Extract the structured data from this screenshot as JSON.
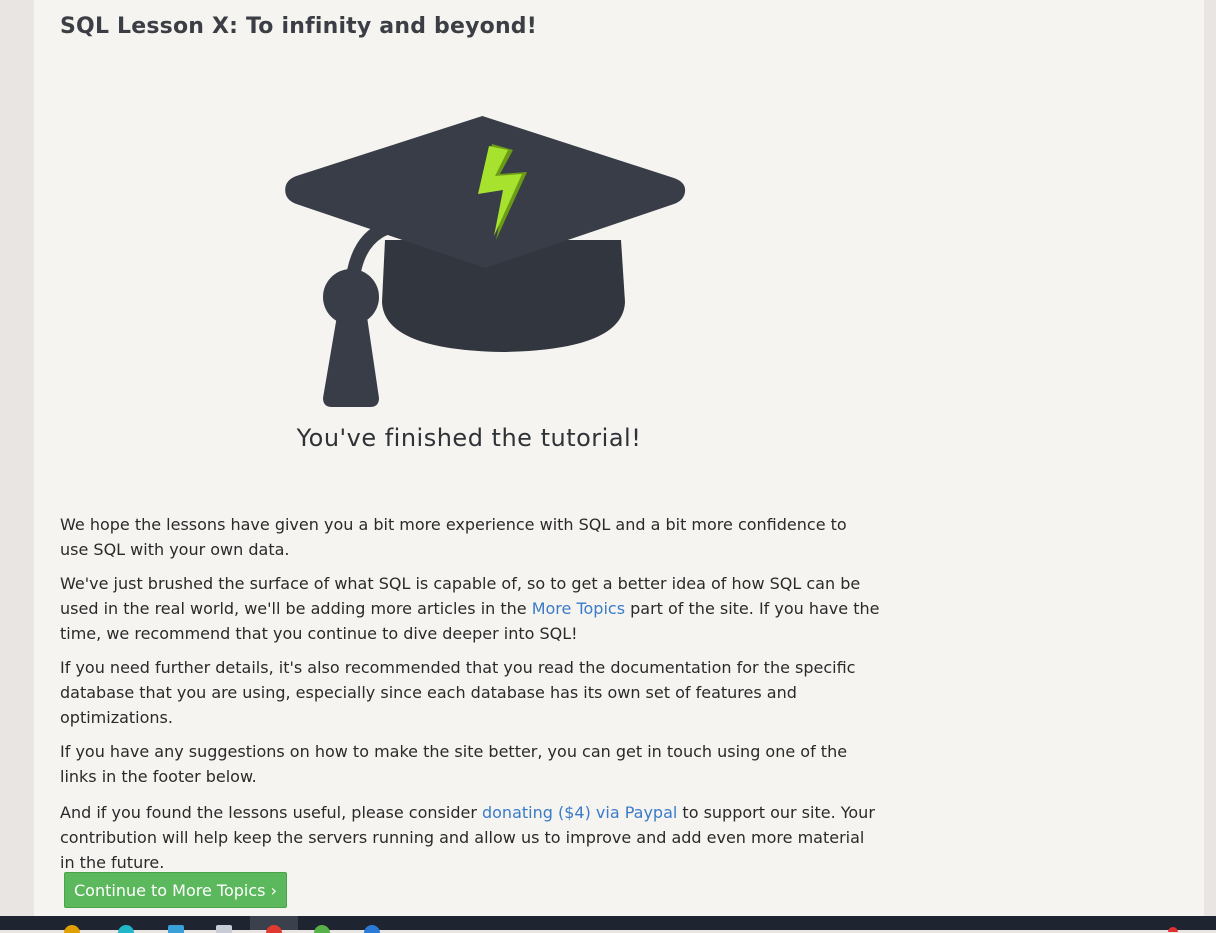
{
  "lesson": {
    "title": "SQL Lesson X: To infinity and beyond!",
    "finished_heading": "You've finished the tutorial!"
  },
  "paragraphs": {
    "p1": "We hope the lessons have given you a bit more experience with SQL and a bit more confidence to use SQL with your own data.",
    "p2_before": "We've just brushed the surface of what SQL is capable of, so to get a better idea of how SQL can be used in the real world, we'll be adding more articles in the ",
    "p2_link": "More Topics",
    "p2_after": " part of the site. If you have the time, we recommend that you continue to dive deeper into SQL!",
    "p3": "If you need further details, it's also recommended that you read the documentation for the specific database that you are using, especially since each database has its own set of features and optimizations.",
    "p4": "If you have any suggestions on how to make the site better, you can get in touch using one of the links in the footer below.",
    "p5_before": "And if you found the lessons useful, please consider ",
    "p5_link": "donating ($4) via Paypal",
    "p5_after": " to support our site. Your contribution will help keep the servers running and allow us to improve and add even more material in the future."
  },
  "continue_button": {
    "label": "Continue to More Topics ›"
  },
  "icons": {
    "cap": "graduation-cap-icon",
    "bolt": "lightning-bolt-icon"
  },
  "colors": {
    "cap": "#393d48",
    "bolt": "#a6e22e",
    "link": "#3b7bc8",
    "button": "#5cb85c",
    "taskbar": "#1f2530"
  }
}
